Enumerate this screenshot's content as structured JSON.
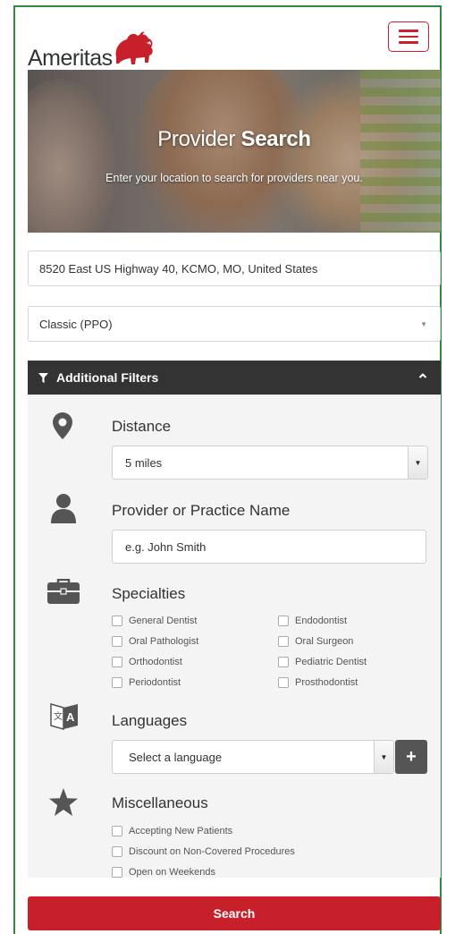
{
  "brand": {
    "name": "Ameritas",
    "color": "#c8202a",
    "logo_icon": "bison-logo"
  },
  "header": {
    "menu_icon": "hamburger-menu-icon"
  },
  "hero": {
    "title_light": "Provider ",
    "title_bold": "Search",
    "subtitle": "Enter your location to search for providers near you."
  },
  "search": {
    "location_value": "8520 East US Highway 40, KCMO, MO, United States",
    "plan_value": "Classic (PPO)"
  },
  "filters": {
    "header_label": "Additional Filters",
    "distance": {
      "title": "Distance",
      "selected": "5 miles",
      "icon": "map-pin-icon"
    },
    "provider": {
      "title": "Provider or Practice Name",
      "placeholder": "e.g. John Smith",
      "icon": "person-icon"
    },
    "specialties": {
      "title": "Specialties",
      "icon": "briefcase-icon",
      "options": [
        "General Dentist",
        "Endodontist",
        "Oral Pathologist",
        "Oral Surgeon",
        "Orthodontist",
        "Pediatric Dentist",
        "Periodontist",
        "Prosthodontist"
      ]
    },
    "languages": {
      "title": "Languages",
      "selected": "Select a language",
      "icon": "translate-icon",
      "add_label": "+"
    },
    "misc": {
      "title": "Miscellaneous",
      "icon": "star-icon",
      "options": [
        "Accepting New Patients",
        "Discount on Non-Covered Procedures",
        "Open on Weekends"
      ]
    }
  },
  "actions": {
    "search_label": "Search"
  }
}
